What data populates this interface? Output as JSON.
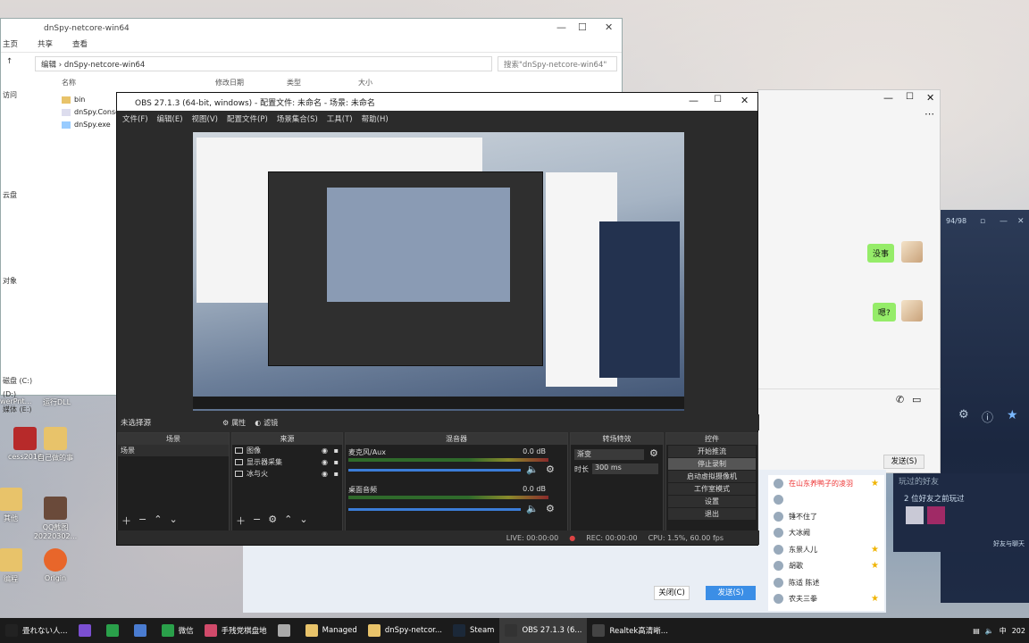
{
  "explorer": {
    "title": "dnSpy-netcore-win64",
    "ribbon": [
      "主页",
      "共享",
      "查看"
    ],
    "path_parts": [
      "编辑",
      "dnSpy-netcore-win64"
    ],
    "search_placeholder": "搜索\"dnSpy-netcore-win64\"",
    "columns": [
      "名称",
      "修改日期",
      "类型",
      "大小"
    ],
    "files": [
      "bin",
      "dnSpy.Conso",
      "dnSpy.exe"
    ],
    "nav": [
      "访问",
      "",
      "",
      "",
      "",
      "",
      "",
      "云盘",
      "",
      "",
      "",
      "",
      "",
      "对象",
      "",
      "",
      "",
      "",
      "",
      "",
      "磁盘 (C:)",
      "(D:)",
      "媒体 (E:)"
    ]
  },
  "desktop": {
    "icons": [
      "cess2016",
      "自己做的事",
      "其他",
      "QQ截图20220302...",
      "编程",
      "Origin"
    ],
    "left_labels": [
      "werPnt...",
      "运行DLL"
    ]
  },
  "obs": {
    "title": "OBS 27.1.3 (64-bit, windows) - 配置文件: 未命名 - 场景: 未命名",
    "menu": [
      "文件(F)",
      "编辑(E)",
      "视图(V)",
      "配置文件(P)",
      "场景集合(S)",
      "工具(T)",
      "帮助(H)"
    ],
    "no_source": "未选择源",
    "properties": "属性",
    "filters": "滤镜",
    "docks": {
      "scenes": "场景",
      "sources": "来源",
      "mixer": "混音器",
      "transitions": "转场特效",
      "controls": "控件"
    },
    "scene_items": [
      "场景"
    ],
    "source_items": [
      "图像",
      "显示器采集",
      "冰与火"
    ],
    "mixer": [
      {
        "name": "麦克风/Aux",
        "db": "0.0 dB"
      },
      {
        "name": "桌面音频",
        "db": "0.0 dB"
      }
    ],
    "transition": {
      "type": "渐变",
      "duration_label": "时长",
      "duration": "300 ms"
    },
    "controls": [
      "开始推流",
      "停止录制",
      "启动虚拟摄像机",
      "工作室模式",
      "设置",
      "退出"
    ],
    "status": {
      "live": "LIVE: 00:00:00",
      "rec": "REC: 00:00:00",
      "cpu": "CPU: 1.5%, 60.00 fps"
    }
  },
  "chat": {
    "messages": [
      "没事",
      "嗯?"
    ],
    "send": "发送(S)",
    "close": "关闭(C)",
    "send_btn": "发送(S)"
  },
  "contacts": [
    {
      "name": "在山东养鸭子的凌羽",
      "star": true
    },
    {
      "name": "",
      "star": false
    },
    {
      "name": "锤不住了",
      "star": false
    },
    {
      "name": "大冰阙",
      "star": false
    },
    {
      "name": "东景人儿",
      "star": true
    },
    {
      "name": "胡歌",
      "star": true
    },
    {
      "name": "陈适  陈述",
      "star": false
    },
    {
      "name": "农夫三拳",
      "star": true
    }
  ],
  "steam": {
    "recent_title": "玩过的好友",
    "recent_desc": "2 位好友之前玩过",
    "friends_label": "好友与聊天",
    "count": "94/98"
  },
  "taskbar": {
    "items": [
      "畳れない人...",
      "",
      "",
      "",
      "微信",
      "手残党棋盘地",
      "",
      "Managed",
      "dnSpy-netcor...",
      "Steam",
      "OBS 27.1.3 (6...",
      "Realtek高清晰..."
    ],
    "tray": [
      "中",
      "202"
    ]
  }
}
